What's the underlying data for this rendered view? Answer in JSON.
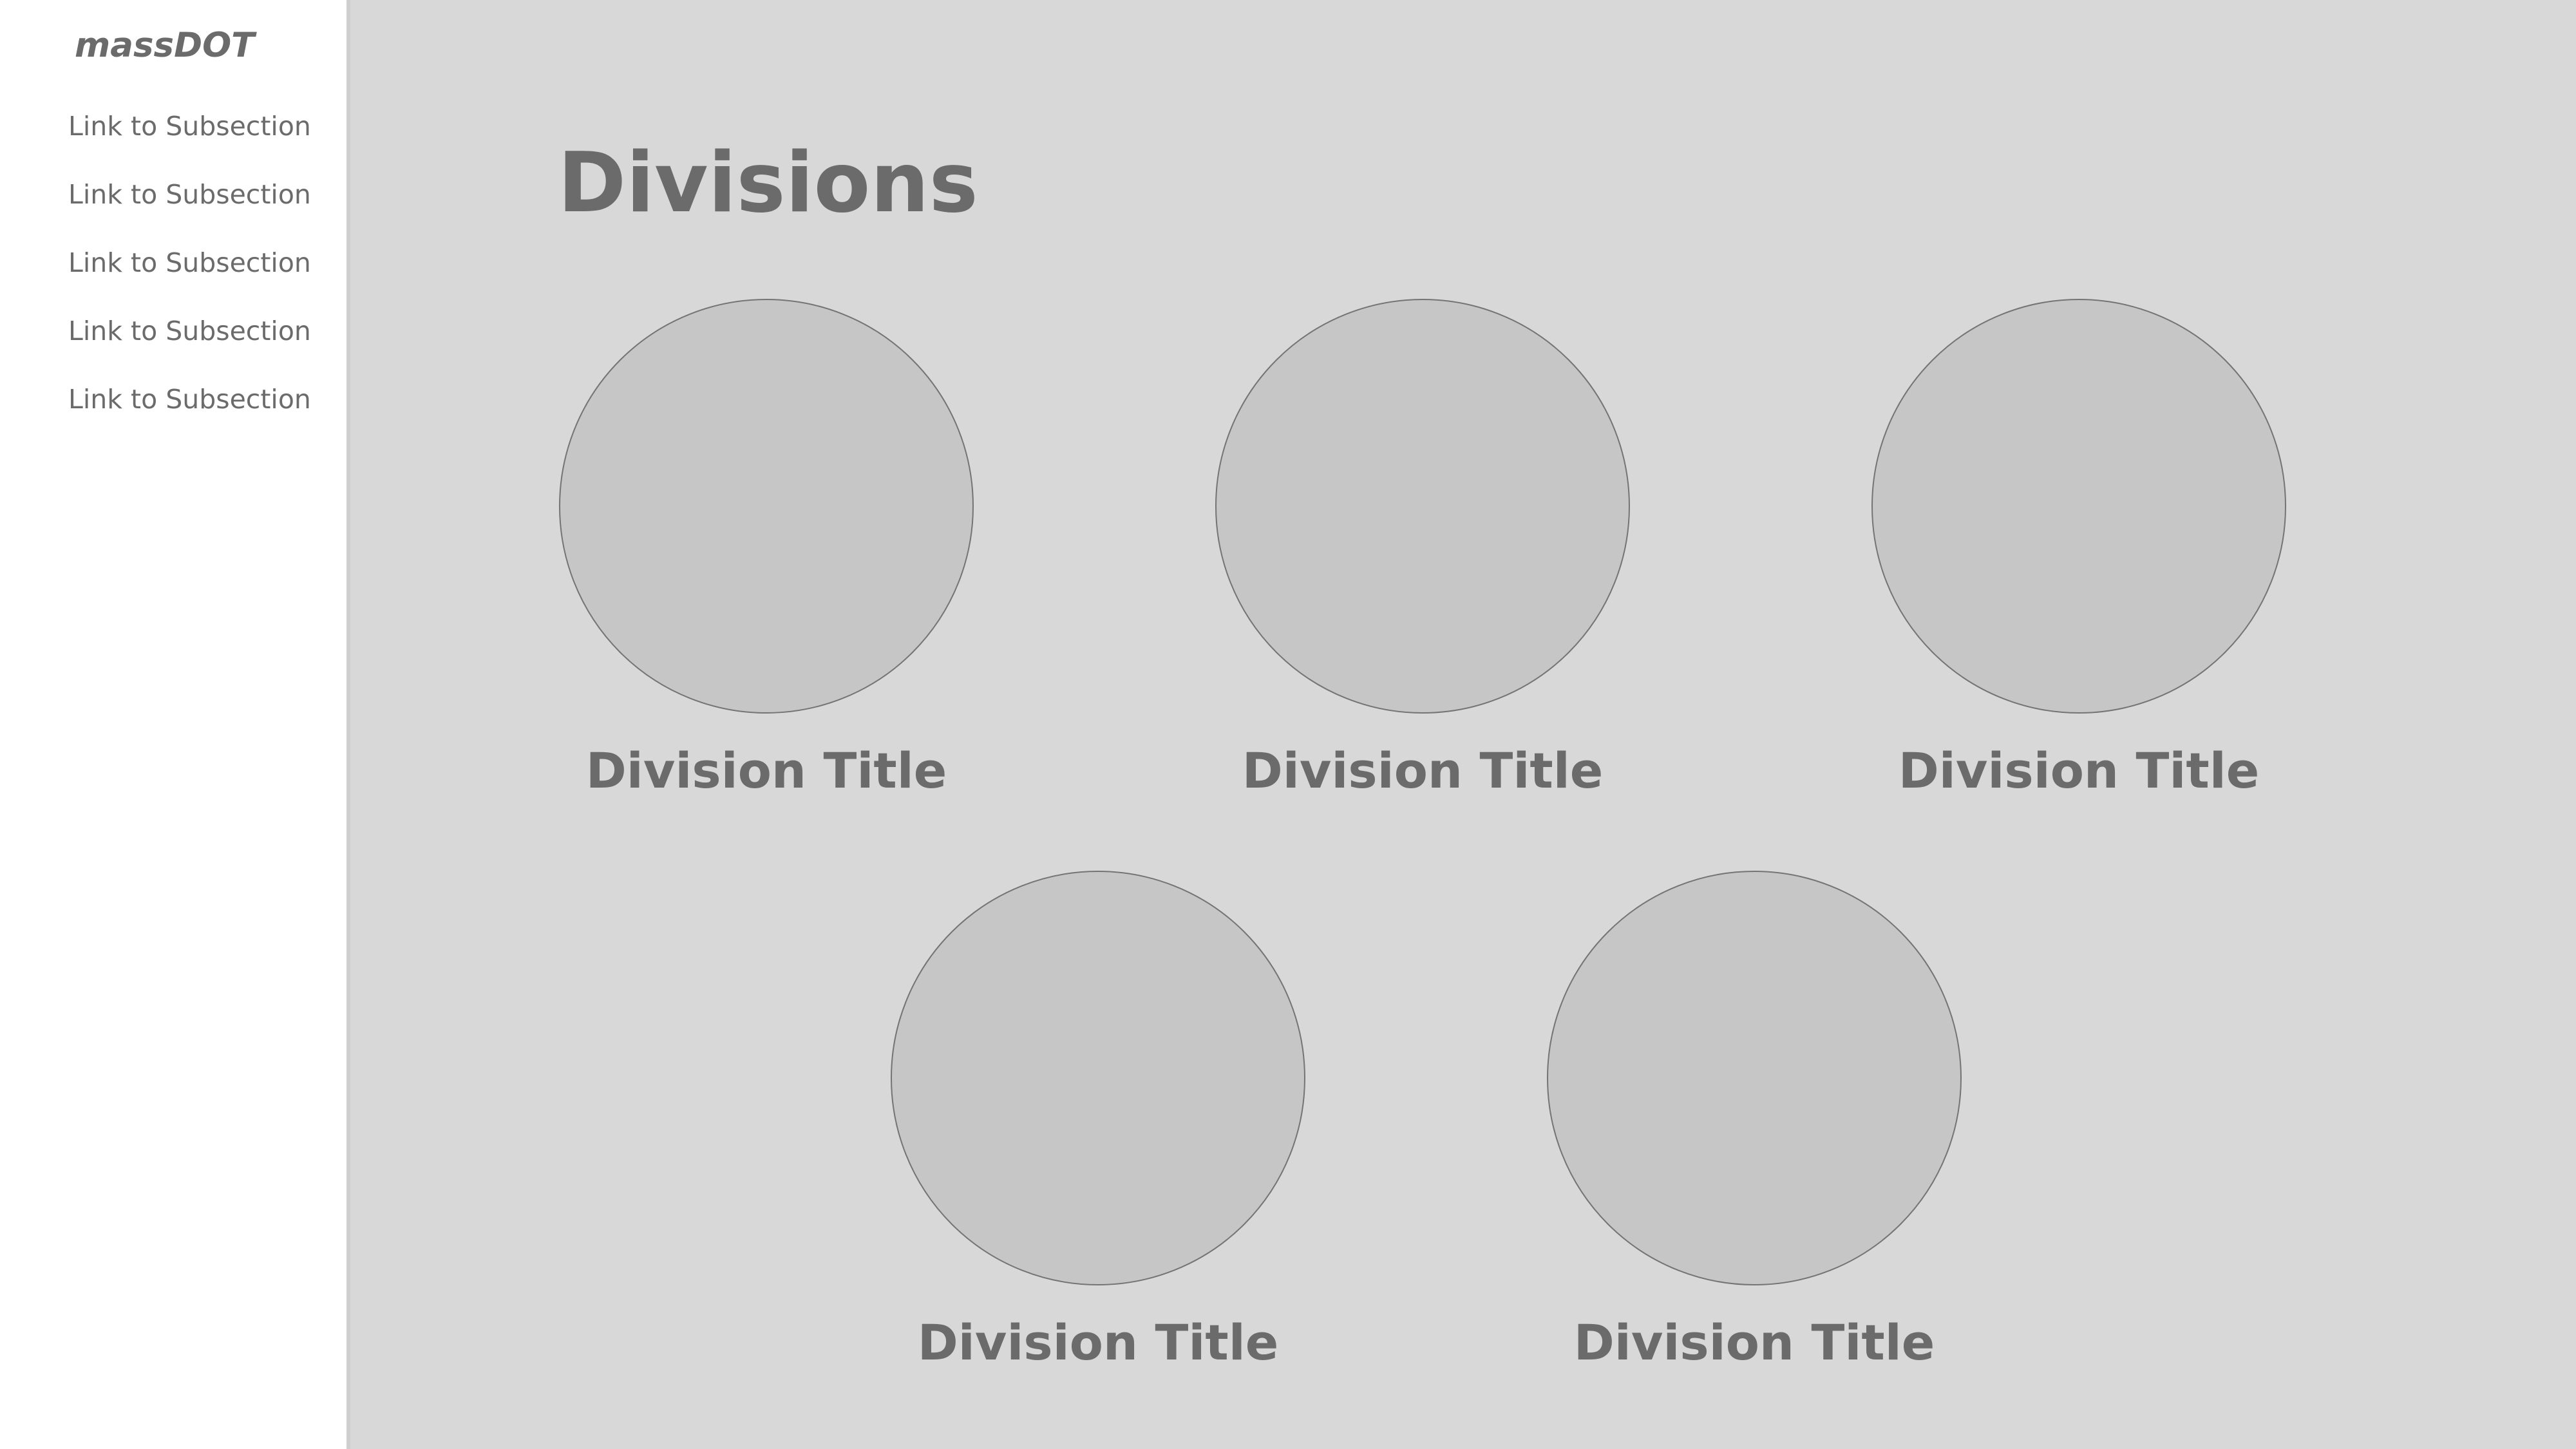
{
  "sidebar": {
    "brand": "massDOT",
    "links": [
      "Link to Subsection",
      "Link to Subsection",
      "Link to Subsection",
      "Link to Subsection",
      "Link to Subsection"
    ]
  },
  "main": {
    "title": "Divisions",
    "divisions": [
      {
        "title": "Division Title"
      },
      {
        "title": "Division Title"
      },
      {
        "title": "Division Title"
      },
      {
        "title": "Division Title"
      },
      {
        "title": "Division Title"
      }
    ]
  },
  "colors": {
    "background": "#d8d8d8",
    "sidebar": "#ffffff",
    "circle": "#c6c6c6",
    "text": "#6b6b6b"
  }
}
